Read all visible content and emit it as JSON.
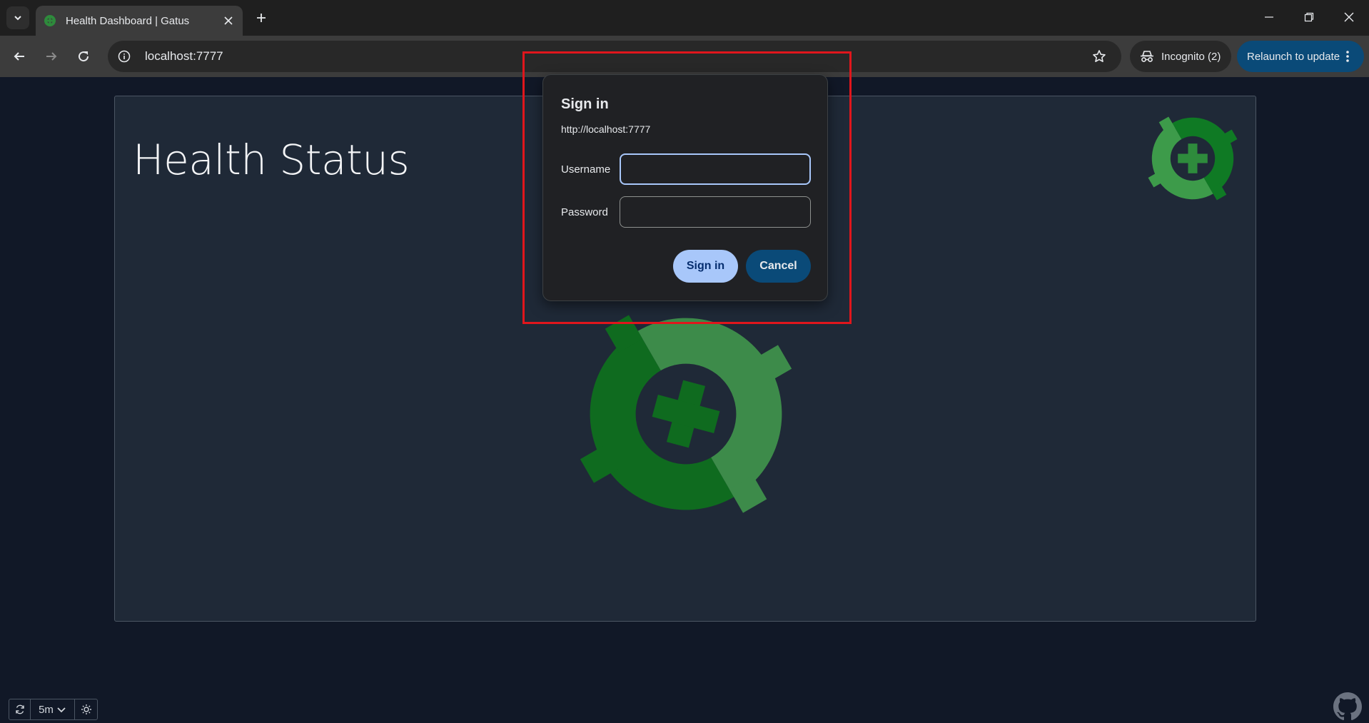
{
  "browser": {
    "tab_title": "Health Dashboard | Gatus",
    "url": "localhost:7777",
    "incognito_label": "Incognito (2)",
    "relaunch_label": "Relaunch to update"
  },
  "page": {
    "title": "Health Status"
  },
  "dialog": {
    "title": "Sign in",
    "origin": "http://localhost:7777",
    "username_label": "Username",
    "username_value": "",
    "password_label": "Password",
    "password_value": "",
    "signin_label": "Sign in",
    "cancel_label": "Cancel"
  },
  "controls": {
    "refresh_interval": "5m"
  },
  "colors": {
    "accent_blue": "#a8c7fa",
    "highlight_red": "#e0161c",
    "logo_dark_green": "#0f6b1f",
    "logo_light_green": "#3d8b4a"
  }
}
